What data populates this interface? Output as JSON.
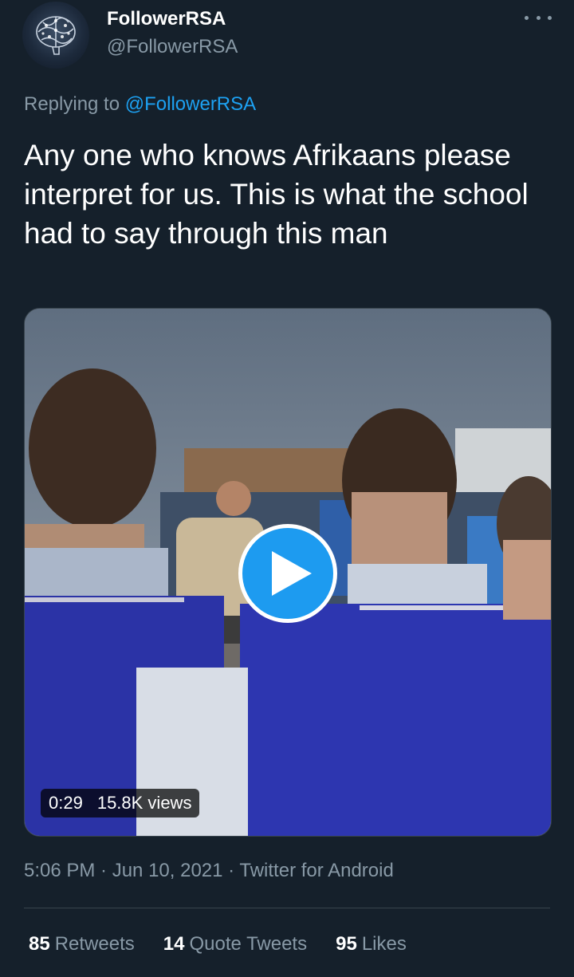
{
  "author": {
    "display_name": "FollowerRSA",
    "handle": "@FollowerRSA"
  },
  "reply_context": {
    "prefix": "Replying to",
    "mention": "@FollowerRSA"
  },
  "tweet": {
    "text": "Any one who knows Afrikaans please interpret for us. This is what the school had to say through this man"
  },
  "video": {
    "duration": "0:29",
    "views": "15.8K views"
  },
  "meta": {
    "timestamp": "5:06 PM · Jun 10, 2021 · Twitter for Android"
  },
  "stats": {
    "retweets_count": "85",
    "retweets_label": "Retweets",
    "quotes_count": "14",
    "quotes_label": "Quote Tweets",
    "likes_count": "95",
    "likes_label": "Likes"
  },
  "colors": {
    "background": "#15202b",
    "accent": "#1d9bf0",
    "secondary_text": "#8899a6"
  },
  "icons": [
    "more-icon",
    "play-icon",
    "avatar-brain-icon"
  ]
}
